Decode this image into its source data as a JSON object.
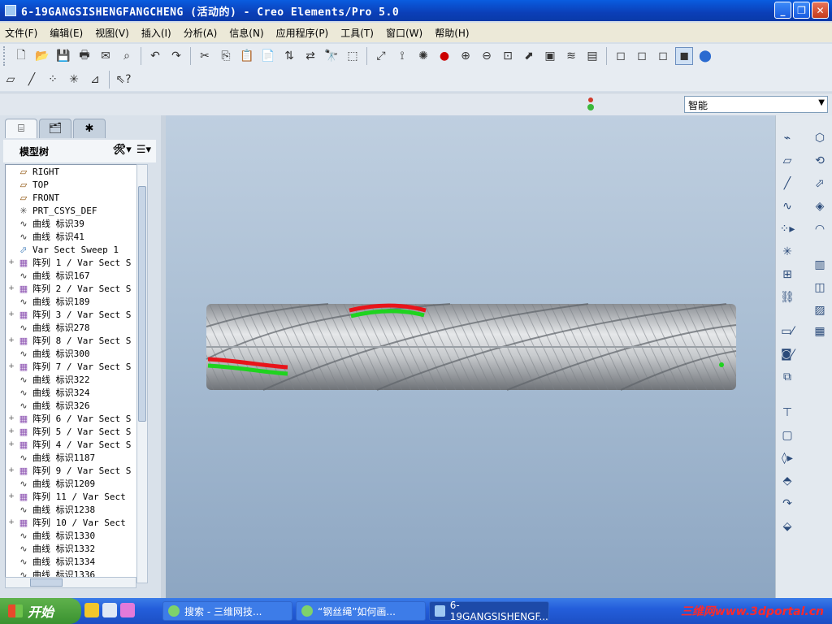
{
  "window": {
    "title": "6-19GANGSISHENGFANGCHENG (活动的) - Creo Elements/Pro 5.0"
  },
  "menubar": {
    "items": [
      "文件(F)",
      "编辑(E)",
      "视图(V)",
      "插入(I)",
      "分析(A)",
      "信息(N)",
      "应用程序(P)",
      "工具(T)",
      "窗口(W)",
      "帮助(H)"
    ]
  },
  "filter": {
    "value": "智能"
  },
  "model_tree": {
    "title": "模型树",
    "items": [
      {
        "label": "RIGHT",
        "icon": "datum-plane-icon",
        "expand": ""
      },
      {
        "label": "TOP",
        "icon": "datum-plane-icon",
        "expand": ""
      },
      {
        "label": "FRONT",
        "icon": "datum-plane-icon",
        "expand": ""
      },
      {
        "label": "PRT_CSYS_DEF",
        "icon": "csys-icon",
        "expand": ""
      },
      {
        "label": "曲线 标识39",
        "icon": "curve-icon",
        "expand": ""
      },
      {
        "label": "曲线 标识41",
        "icon": "curve-icon",
        "expand": ""
      },
      {
        "label": "Var Sect Sweep 1",
        "icon": "sweep-icon",
        "expand": ""
      },
      {
        "label": "阵列 1 / Var Sect S",
        "icon": "pattern-icon",
        "expand": "+"
      },
      {
        "label": "曲线 标识167",
        "icon": "curve-icon",
        "expand": ""
      },
      {
        "label": "阵列 2 / Var Sect S",
        "icon": "pattern-icon",
        "expand": "+"
      },
      {
        "label": "曲线 标识189",
        "icon": "curve-icon",
        "expand": ""
      },
      {
        "label": "阵列 3 / Var Sect S",
        "icon": "pattern-icon",
        "expand": "+"
      },
      {
        "label": "曲线 标识278",
        "icon": "curve-icon",
        "expand": ""
      },
      {
        "label": "阵列 8 / Var Sect S",
        "icon": "pattern-icon",
        "expand": "+"
      },
      {
        "label": "曲线 标识300",
        "icon": "curve-icon",
        "expand": ""
      },
      {
        "label": "阵列 7 / Var Sect S",
        "icon": "pattern-icon",
        "expand": "+"
      },
      {
        "label": "曲线 标识322",
        "icon": "curve-icon",
        "expand": ""
      },
      {
        "label": "曲线 标识324",
        "icon": "curve-icon",
        "expand": ""
      },
      {
        "label": "曲线 标识326",
        "icon": "curve-icon",
        "expand": ""
      },
      {
        "label": "阵列 6 / Var Sect S",
        "icon": "pattern-icon",
        "expand": "+"
      },
      {
        "label": "阵列 5 / Var Sect S",
        "icon": "pattern-icon",
        "expand": "+"
      },
      {
        "label": "阵列 4 / Var Sect S",
        "icon": "pattern-icon",
        "expand": "+"
      },
      {
        "label": "曲线 标识1187",
        "icon": "curve-icon",
        "expand": ""
      },
      {
        "label": "阵列 9 / Var Sect S",
        "icon": "pattern-icon",
        "expand": "+"
      },
      {
        "label": "曲线 标识1209",
        "icon": "curve-icon",
        "expand": ""
      },
      {
        "label": "阵列 11 / Var Sect",
        "icon": "pattern-icon",
        "expand": "+"
      },
      {
        "label": "曲线 标识1238",
        "icon": "curve-icon",
        "expand": ""
      },
      {
        "label": "阵列 10 / Var Sect",
        "icon": "pattern-icon",
        "expand": "+"
      },
      {
        "label": "曲线 标识1330",
        "icon": "curve-icon",
        "expand": ""
      },
      {
        "label": "曲线 标识1332",
        "icon": "curve-icon",
        "expand": ""
      },
      {
        "label": "曲线 标识1334",
        "icon": "curve-icon",
        "expand": ""
      },
      {
        "label": "曲线 标识1336",
        "icon": "curve-icon",
        "expand": ""
      }
    ]
  },
  "taskbar": {
    "start_label": "开始",
    "tasks": [
      {
        "label": "搜索 - 三维网技..."
      },
      {
        "label": "“钢丝绳”如何画..."
      },
      {
        "label": "6-19GANGSISHENGF..."
      }
    ],
    "watermark": "三维网www.3dportal.cn"
  },
  "colors": {
    "accent": "#0b3fb8",
    "highlight_red": "#e8141a",
    "highlight_green": "#1fd31f"
  }
}
